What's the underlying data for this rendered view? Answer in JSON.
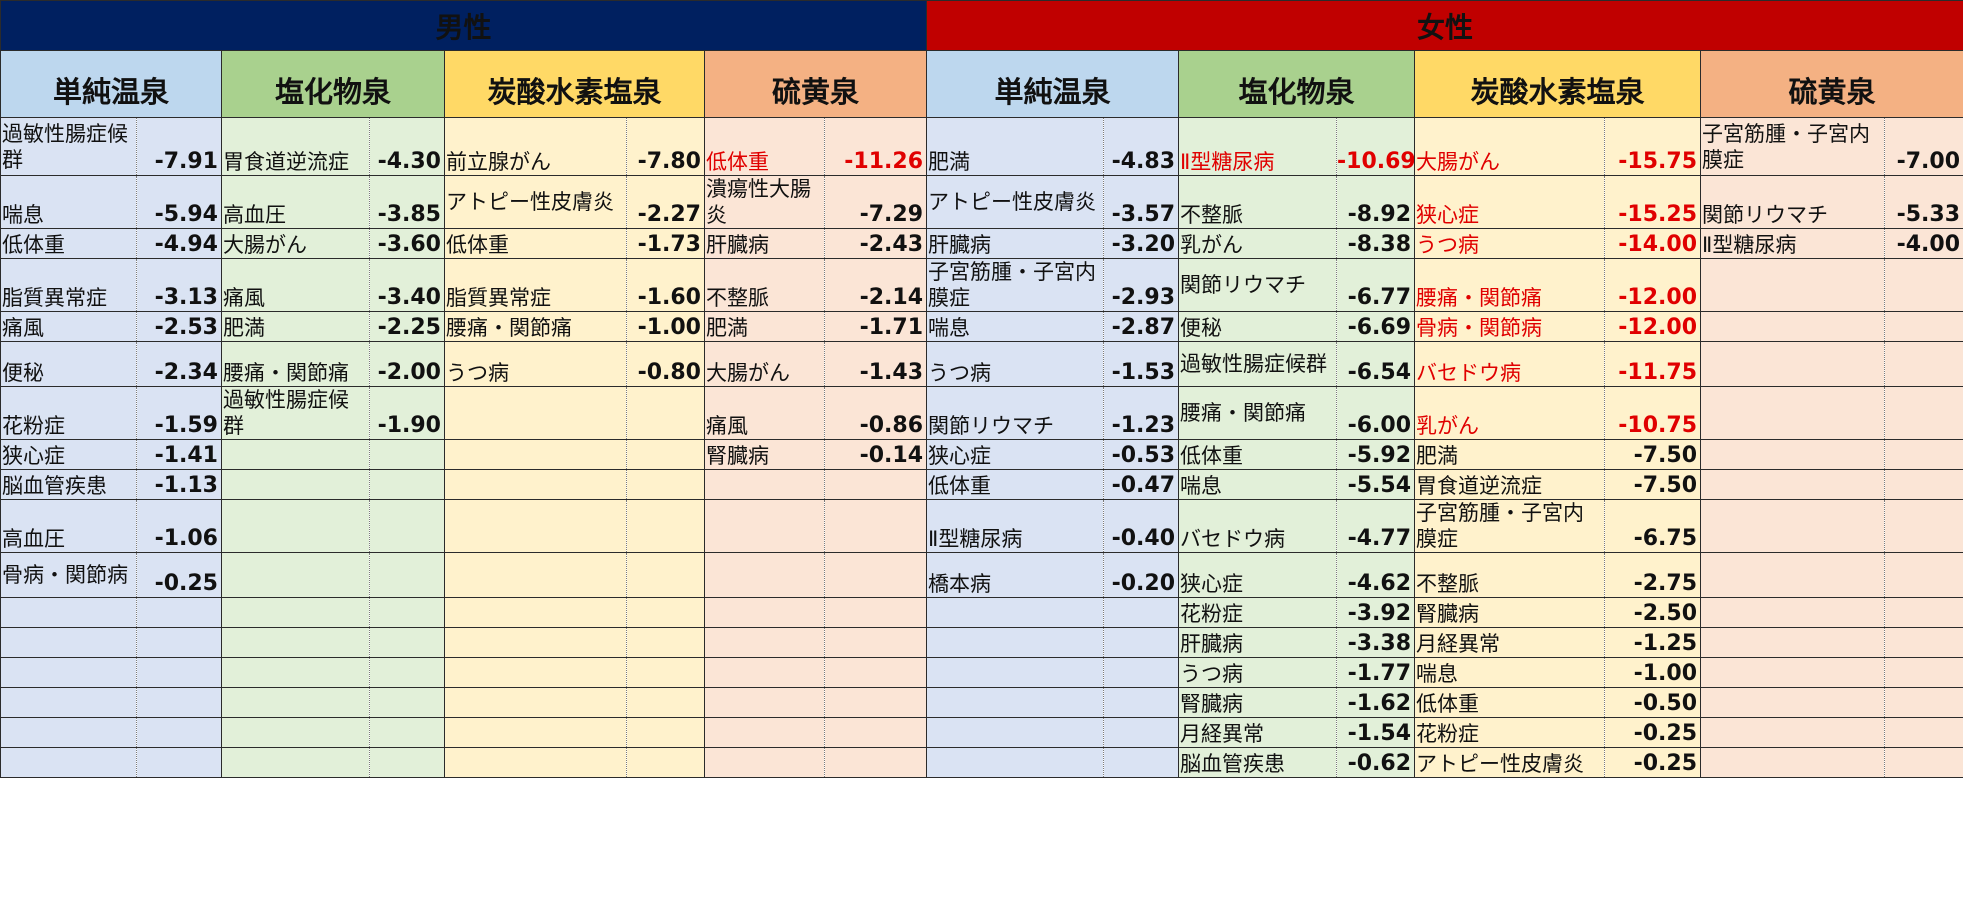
{
  "headers": {
    "male": "男性",
    "female": "女性"
  },
  "spring_types": {
    "simple": "単純温泉",
    "chloride": "塩化物泉",
    "bicarbonate": "炭酸水素塩泉",
    "sulfur": "硫黄泉"
  },
  "columns": {
    "male_simple": [
      {
        "name": "過敏性腸症候群",
        "value": "-7.91"
      },
      {
        "name": "喘息",
        "value": "-5.94"
      },
      {
        "name": "低体重",
        "value": "-4.94"
      },
      {
        "name": "脂質異常症",
        "value": "-3.13"
      },
      {
        "name": "痛風",
        "value": "-2.53"
      },
      {
        "name": "便秘",
        "value": "-2.34"
      },
      {
        "name": "花粉症",
        "value": "-1.59"
      },
      {
        "name": "狭心症",
        "value": "-1.41"
      },
      {
        "name": "脳血管疾患",
        "value": "-1.13"
      },
      {
        "name": "高血圧",
        "value": "-1.06"
      },
      {
        "name": "骨病・関節病",
        "value": "-0.25"
      }
    ],
    "male_chloride": [
      {
        "name": "胃食道逆流症",
        "value": "-4.30"
      },
      {
        "name": "高血圧",
        "value": "-3.85"
      },
      {
        "name": "大腸がん",
        "value": "-3.60"
      },
      {
        "name": "痛風",
        "value": "-3.40"
      },
      {
        "name": "肥満",
        "value": "-2.25"
      },
      {
        "name": "腰痛・関節痛",
        "value": "-2.00"
      },
      {
        "name": "過敏性腸症候群",
        "value": "-1.90"
      }
    ],
    "male_bicarbonate": [
      {
        "name": "前立腺がん",
        "value": "-7.80"
      },
      {
        "name": "アトピー性皮膚炎",
        "value": "-2.27"
      },
      {
        "name": "低体重",
        "value": "-1.73"
      },
      {
        "name": "脂質異常症",
        "value": "-1.60"
      },
      {
        "name": "腰痛・関節痛",
        "value": "-1.00"
      },
      {
        "name": "うつ病",
        "value": "-0.80"
      }
    ],
    "male_sulfur": [
      {
        "name": "低体重",
        "value": "-11.26",
        "highlight": true
      },
      {
        "name": "潰瘍性大腸炎",
        "value": "-7.29"
      },
      {
        "name": "肝臓病",
        "value": "-2.43"
      },
      {
        "name": "不整脈",
        "value": "-2.14"
      },
      {
        "name": "肥満",
        "value": "-1.71"
      },
      {
        "name": "大腸がん",
        "value": "-1.43"
      },
      {
        "name": "痛風",
        "value": "-0.86"
      },
      {
        "name": "腎臓病",
        "value": "-0.14"
      }
    ],
    "female_simple": [
      {
        "name": "肥満",
        "value": "-4.83"
      },
      {
        "name": "アトピー性皮膚炎",
        "value": "-3.57"
      },
      {
        "name": "肝臓病",
        "value": "-3.20"
      },
      {
        "name": "子宮筋腫・子宮内膜症",
        "value": "-2.93"
      },
      {
        "name": "喘息",
        "value": "-2.87"
      },
      {
        "name": "うつ病",
        "value": "-1.53"
      },
      {
        "name": "関節リウマチ",
        "value": "-1.23"
      },
      {
        "name": "狭心症",
        "value": "-0.53"
      },
      {
        "name": "低体重",
        "value": "-0.47"
      },
      {
        "name": "Ⅱ型糖尿病",
        "value": "-0.40"
      },
      {
        "name": "橋本病",
        "value": "-0.20"
      }
    ],
    "female_chloride": [
      {
        "name": "Ⅱ型糖尿病",
        "value": "-10.69",
        "highlight": true
      },
      {
        "name": "不整脈",
        "value": "-8.92"
      },
      {
        "name": "乳がん",
        "value": "-8.38"
      },
      {
        "name": "関節リウマチ",
        "value": "-6.77"
      },
      {
        "name": "便秘",
        "value": "-6.69"
      },
      {
        "name": "過敏性腸症候群",
        "value": "-6.54"
      },
      {
        "name": "腰痛・関節痛",
        "value": "-6.00"
      },
      {
        "name": "低体重",
        "value": "-5.92"
      },
      {
        "name": "喘息",
        "value": "-5.54"
      },
      {
        "name": "バセドウ病",
        "value": "-4.77"
      },
      {
        "name": "狭心症",
        "value": "-4.62"
      },
      {
        "name": "花粉症",
        "value": "-3.92"
      },
      {
        "name": "肝臓病",
        "value": "-3.38"
      },
      {
        "name": "うつ病",
        "value": "-1.77"
      },
      {
        "name": "腎臓病",
        "value": "-1.62"
      },
      {
        "name": "月経異常",
        "value": "-1.54"
      },
      {
        "name": "脳血管疾患",
        "value": "-0.62"
      }
    ],
    "female_bicarbonate": [
      {
        "name": "大腸がん",
        "value": "-15.75",
        "highlight": true
      },
      {
        "name": "狭心症",
        "value": "-15.25",
        "highlight": true
      },
      {
        "name": "うつ病",
        "value": "-14.00",
        "highlight": true
      },
      {
        "name": "腰痛・関節痛",
        "value": "-12.00",
        "highlight": true
      },
      {
        "name": "骨病・関節病",
        "value": "-12.00",
        "highlight": true
      },
      {
        "name": "バセドウ病",
        "value": "-11.75",
        "highlight": true
      },
      {
        "name": "乳がん",
        "value": "-10.75",
        "highlight": true
      },
      {
        "name": "肥満",
        "value": "-7.50"
      },
      {
        "name": "胃食道逆流症",
        "value": "-7.50"
      },
      {
        "name": "子宮筋腫・子宮内膜症",
        "value": "-6.75"
      },
      {
        "name": "不整脈",
        "value": "-2.75"
      },
      {
        "name": "腎臓病",
        "value": "-2.50"
      },
      {
        "name": "月経異常",
        "value": "-1.25"
      },
      {
        "name": "喘息",
        "value": "-1.00"
      },
      {
        "name": "低体重",
        "value": "-0.50"
      },
      {
        "name": "花粉症",
        "value": "-0.25"
      },
      {
        "name": "アトピー性皮膚炎",
        "value": "-0.25"
      }
    ],
    "female_sulfur": [
      {
        "name": "子宮筋腫・子宮内膜症",
        "value": "-7.00"
      },
      {
        "name": "関節リウマチ",
        "value": "-5.33"
      },
      {
        "name": "Ⅱ型糖尿病",
        "value": "-4.00"
      }
    ]
  },
  "colors": {
    "male_header": "#002060",
    "female_header": "#c00000",
    "highlight_text": "#e00000",
    "simple_header": "#bdd7ee",
    "simple_body": "#dae3f3",
    "chloride_header": "#a9d18e",
    "chloride_body": "#e2f0d9",
    "bicarbonate_header": "#ffd966",
    "bicarbonate_body": "#fff2cc",
    "sulfur_header": "#f4b183",
    "sulfur_body": "#fbe5d6"
  }
}
